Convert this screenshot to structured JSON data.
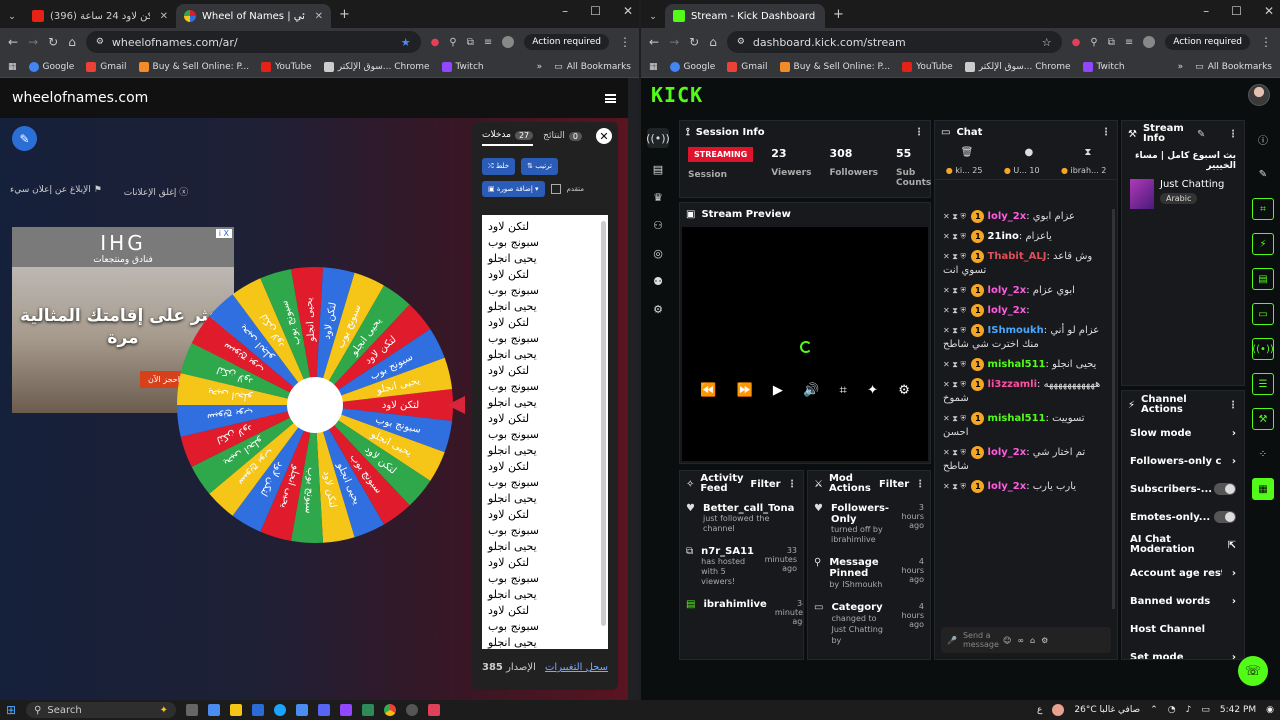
{
  "left_browser": {
    "tabs": [
      {
        "title": "(396) لتكن لاود 24 ساعة - YouTube",
        "active": false
      },
      {
        "title": "Wheel of Names | العشوائي",
        "active": true
      }
    ],
    "new_tab": "+",
    "url": "wheelofnames.com/ar/",
    "action_required": "Action required",
    "bookmarks": [
      "Google",
      "Gmail",
      "Buy & Sell Online: P...",
      "YouTube",
      "سوق الإلكتر... Chrome",
      "Twitch"
    ],
    "all_bookmarks": "All Bookmarks"
  },
  "wheel_page": {
    "site_title": "wheelofnames.com",
    "close_ads": "إغلق الإعلانات",
    "report_ad": "الإبلاغ عن إعلان سيء",
    "ad": {
      "brand": "IHG",
      "brand_sub": "فنادق ومنتجعات",
      "headline": "اعثر على إقامتك المثالية",
      "headline2": "مرة",
      "cta": "احجز الآن",
      "info": "i X"
    },
    "wheel_labels": [
      "لتكن لاود",
      "سبونج بوب",
      "يحيى انجلو"
    ],
    "wheel_colors": [
      "#e01b2c",
      "#2f6fe0",
      "#f5c518",
      "#2ea84a"
    ],
    "panel": {
      "tab_entries": "مدخلات",
      "tab_entries_count": "27",
      "tab_results": "النتائج",
      "tab_results_count": "0",
      "shuffle": "خلط",
      "sort": "ترتيب",
      "add_image": "إضافة صورة",
      "advanced": "متقدم",
      "entries": [
        "لتكن لاود",
        "سبونج بوب",
        "يحيى انجلو",
        "لتكن لاود",
        "سبونج بوب",
        "يحيى انجلو",
        "لتكن لاود",
        "سبونج بوب",
        "يحيى انجلو",
        "لتكن لاود",
        "سبونج بوب",
        "يحيى انجلو",
        "لتكن لاود",
        "سبونج بوب",
        "يحيى انجلو",
        "لتكن لاود",
        "سبونج بوب",
        "يحيى انجلو",
        "لتكن لاود",
        "سبونج بوب",
        "يحيى انجلو",
        "لتكن لاود",
        "سبونج بوب",
        "يحيى انجلو",
        "لتكن لاود",
        "سبونج بوب",
        "يحيى انجلو"
      ],
      "version_label": "الإصدار",
      "version": "385",
      "changelog": "سجل التغييرات"
    }
  },
  "right_browser": {
    "tab": "Stream - Kick Dashboard",
    "new_tab": "+",
    "url": "dashboard.kick.com/stream",
    "action_required": "Action required",
    "bookmarks": [
      "Google",
      "Gmail",
      "Buy & Sell Online: P...",
      "YouTube",
      "سوق الإلكتر... Chrome",
      "Twitch"
    ],
    "all_bookmarks": "All Bookmarks"
  },
  "kick": {
    "logo": "KICK",
    "session": {
      "title": "Session Info",
      "status": "STREAMING",
      "session_label": "Session",
      "viewers": "23",
      "viewers_label": "Viewers",
      "followers": "308",
      "followers_label": "Followers",
      "subs": "55",
      "subs_label": "Sub Counts"
    },
    "preview": {
      "title": "Stream Preview"
    },
    "chat": {
      "title": "Chat",
      "top_chatters": [
        {
          "name": "ki...",
          "count": "25"
        },
        {
          "name": "U...",
          "count": "10"
        },
        {
          "name": "ibrah...",
          "count": "2"
        }
      ],
      "messages": [
        {
          "user": "loly_2x",
          "color": "#ff5ce1",
          "text": "عزام ابوي"
        },
        {
          "user": "21ino",
          "color": "#ffffff",
          "text": "ياعزام"
        },
        {
          "user": "Thabit_ALJ",
          "color": "#e0505a",
          "text": "وش قاعد تسوي انت"
        },
        {
          "user": "loly_2x",
          "color": "#ff5ce1",
          "text": "ابوي عزام"
        },
        {
          "user": "loly_2x",
          "color": "#ff5ce1",
          "text": ""
        },
        {
          "user": "IShmoukh",
          "color": "#4aa8ff",
          "text": "عزام لو أني منك اخترت شي شاطح"
        },
        {
          "user": "mishal511",
          "color": "#53fc18",
          "text": "يحيى انجلو"
        },
        {
          "user": "li3zzamli",
          "color": "#ff4fa3",
          "text": "هههههههههههه شموخ"
        },
        {
          "user": "mishal511",
          "color": "#53fc18",
          "text": "تسوييت احسن"
        },
        {
          "user": "loly_2x",
          "color": "#ff5ce1",
          "text": "تم اختار شي شاطح"
        },
        {
          "user": "loly_2x",
          "color": "#ff5ce1",
          "text": "يارب يارب"
        }
      ],
      "send_placeholder": "Send a message"
    },
    "activity": {
      "title": "Activity Feed",
      "filter": "Filter",
      "items": [
        {
          "user": "Better_call_Tona",
          "time": "mi",
          "desc": "just followed the channel"
        },
        {
          "user": "n7r_SA11",
          "time": "33 minutes ago",
          "desc": "has hosted with 5 viewers!"
        },
        {
          "user": "ibrahimlive",
          "time": "34 minutes ago",
          "desc": ""
        }
      ]
    },
    "mod_actions": {
      "title": "Mod Actions",
      "filter": "Filter",
      "items": [
        {
          "title": "Followers-Only",
          "time": "3 hours ago",
          "desc": "turned off by",
          "by": "ibrahimlive"
        },
        {
          "title": "Message Pinned",
          "time": "4 hours ago",
          "desc": "by",
          "by": "IShmoukh"
        },
        {
          "title": "Category",
          "time": "4 hours ago",
          "desc": "changed to",
          "by": "Just Chatting by"
        }
      ]
    },
    "stream_info": {
      "title": "Stream Info",
      "stream_title": "بث اسبوع كامل | مساء الخييير",
      "category": "Just Chatting",
      "language": "Arabic"
    },
    "channel_actions": {
      "title": "Channel Actions",
      "rows": [
        "Slow mode",
        "Followers-only cha",
        "Subscribers-...",
        "Emotes-only...",
        "AI Chat Moderation",
        "Account age restri",
        "Banned words",
        "Host Channel",
        "Set mode"
      ]
    }
  },
  "taskbar": {
    "search": "Search",
    "weather": "26°C",
    "weather_desc": "صافي غالبا",
    "lang": "ع",
    "time": "5:42 PM"
  }
}
